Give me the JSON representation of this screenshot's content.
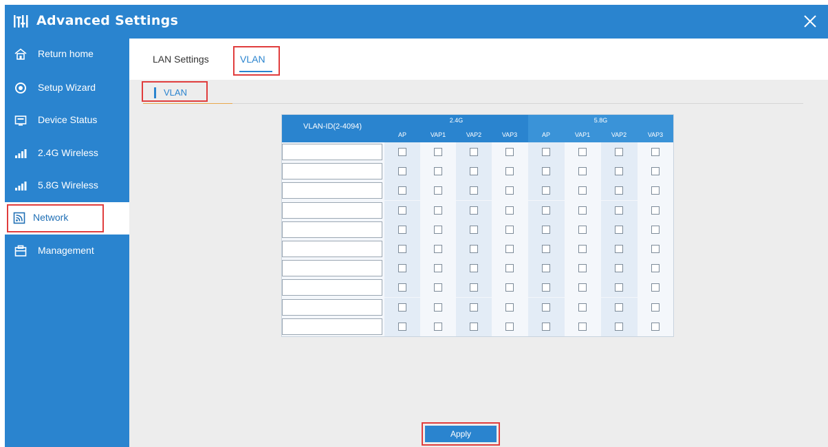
{
  "window": {
    "title": "Advanced Settings"
  },
  "sidebar": {
    "items": [
      {
        "label": "Return home",
        "icon": "home-icon",
        "active": false
      },
      {
        "label": "Setup Wizard",
        "icon": "wizard-icon",
        "active": false
      },
      {
        "label": "Device Status",
        "icon": "device-status-icon",
        "active": false
      },
      {
        "label": "2.4G Wireless",
        "icon": "signal-icon",
        "active": false
      },
      {
        "label": "5.8G Wireless",
        "icon": "signal-icon",
        "active": false
      },
      {
        "label": "Network",
        "icon": "network-icon",
        "active": true
      },
      {
        "label": "Management",
        "icon": "management-icon",
        "active": false
      }
    ]
  },
  "tabs": [
    {
      "label": "LAN Settings",
      "active": false
    },
    {
      "label": "VLAN",
      "active": true
    }
  ],
  "section": {
    "title": "VLAN"
  },
  "table": {
    "id_header": "VLAN-ID(2-4094)",
    "groups": [
      {
        "label": "2.4G",
        "columns": [
          "AP",
          "VAP1",
          "VAP2",
          "VAP3"
        ]
      },
      {
        "label": "5.8G",
        "columns": [
          "AP",
          "VAP1",
          "VAP2",
          "VAP3"
        ]
      }
    ],
    "rows": [
      {
        "vlan_id": "",
        "checks": [
          false,
          false,
          false,
          false,
          false,
          false,
          false,
          false
        ]
      },
      {
        "vlan_id": "",
        "checks": [
          false,
          false,
          false,
          false,
          false,
          false,
          false,
          false
        ]
      },
      {
        "vlan_id": "",
        "checks": [
          false,
          false,
          false,
          false,
          false,
          false,
          false,
          false
        ]
      },
      {
        "vlan_id": "",
        "checks": [
          false,
          false,
          false,
          false,
          false,
          false,
          false,
          false
        ]
      },
      {
        "vlan_id": "",
        "checks": [
          false,
          false,
          false,
          false,
          false,
          false,
          false,
          false
        ]
      },
      {
        "vlan_id": "",
        "checks": [
          false,
          false,
          false,
          false,
          false,
          false,
          false,
          false
        ]
      },
      {
        "vlan_id": "",
        "checks": [
          false,
          false,
          false,
          false,
          false,
          false,
          false,
          false
        ]
      },
      {
        "vlan_id": "",
        "checks": [
          false,
          false,
          false,
          false,
          false,
          false,
          false,
          false
        ]
      },
      {
        "vlan_id": "",
        "checks": [
          false,
          false,
          false,
          false,
          false,
          false,
          false,
          false
        ]
      },
      {
        "vlan_id": "",
        "checks": [
          false,
          false,
          false,
          false,
          false,
          false,
          false,
          false
        ]
      }
    ]
  },
  "actions": {
    "apply_label": "Apply"
  },
  "colors": {
    "primary": "#2a84cf",
    "highlight": "#e03c3c",
    "content_bg": "#ededed"
  }
}
